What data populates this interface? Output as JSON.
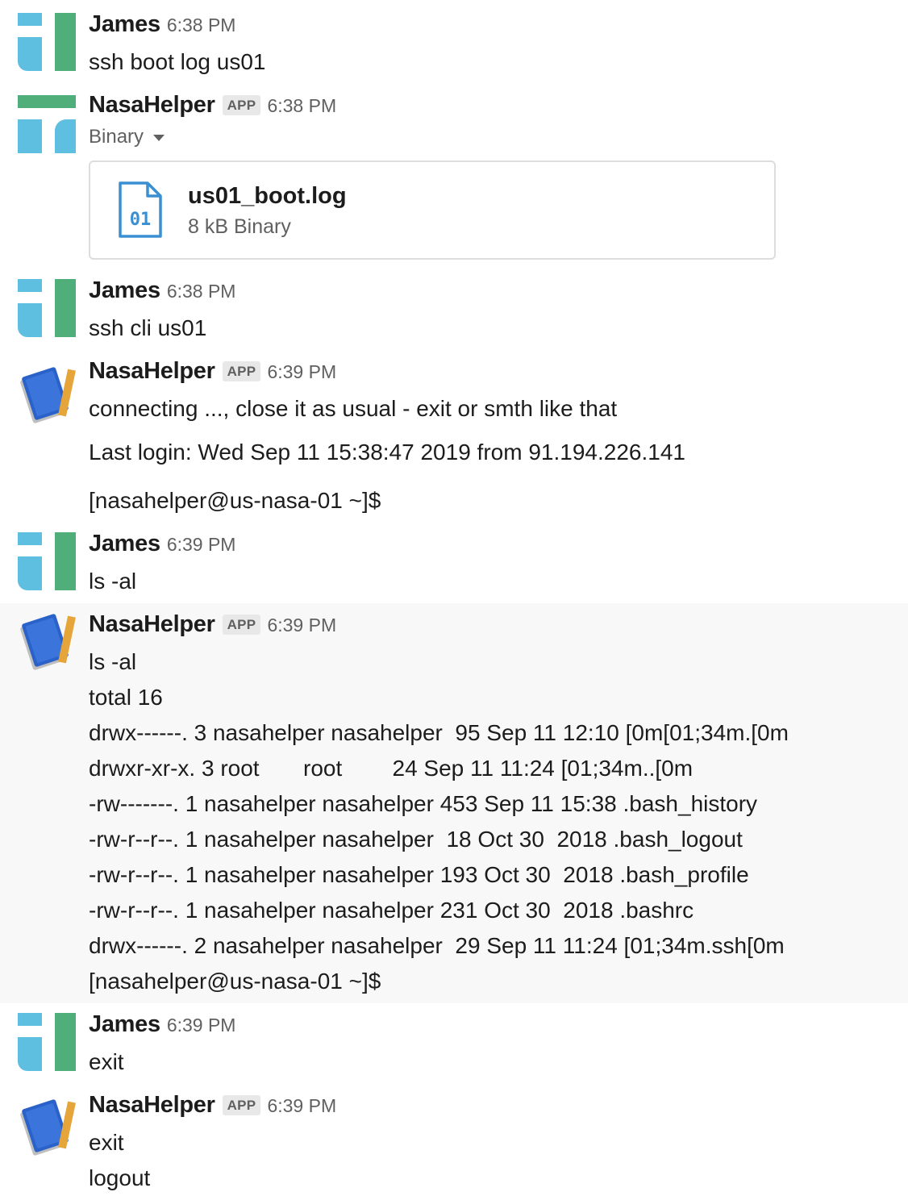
{
  "messages": [
    {
      "author": "James",
      "time": "6:38 PM",
      "avatar_icon": "james-avatar-icon",
      "lines": [
        "ssh boot log us01"
      ]
    },
    {
      "author": "NasaHelper",
      "badge": "APP",
      "time": "6:38 PM",
      "avatar_icon": "nasahelper-avatar-icon",
      "subtitle": "Binary",
      "file": {
        "name": "us01_boot.log",
        "meta": "8 kB Binary",
        "icon_text": "01",
        "icon": "binary-file-icon"
      }
    },
    {
      "author": "James",
      "time": "6:38 PM",
      "avatar_icon": "james-avatar-icon",
      "lines": [
        "ssh cli us01"
      ]
    },
    {
      "author": "NasaHelper",
      "badge": "APP",
      "time": "6:39 PM",
      "avatar_icon": "notebook-avatar-icon",
      "lines": [
        "connecting ..., close it as usual - exit or smth like that",
        "Last login: Wed Sep 11 15:38:47 2019 from 91.194.226.141",
        "[nasahelper@us-nasa-01 ~]$"
      ]
    },
    {
      "author": "James",
      "time": "6:39 PM",
      "avatar_icon": "james-avatar-icon",
      "lines": [
        "ls -al"
      ]
    },
    {
      "author": "NasaHelper",
      "badge": "APP",
      "time": "6:39 PM",
      "avatar_icon": "notebook-avatar-icon",
      "lines": [
        "ls -al",
        "total 16",
        "drwx------. 3 nasahelper nasahelper  95 Sep 11 12:10 [0m[01;34m.[0m",
        "drwxr-xr-x. 3 root       root        24 Sep 11 11:24 [01;34m..[0m",
        "-rw-------. 1 nasahelper nasahelper 453 Sep 11 15:38 .bash_history",
        "-rw-r--r--. 1 nasahelper nasahelper  18 Oct 30  2018 .bash_logout",
        "-rw-r--r--. 1 nasahelper nasahelper 193 Oct 30  2018 .bash_profile",
        "-rw-r--r--. 1 nasahelper nasahelper 231 Oct 30  2018 .bashrc",
        "drwx------. 2 nasahelper nasahelper  29 Sep 11 11:24 [01;34m.ssh[0m",
        "[nasahelper@us-nasa-01 ~]$"
      ]
    },
    {
      "author": "James",
      "time": "6:39 PM",
      "avatar_icon": "james-avatar-icon",
      "lines": [
        "exit"
      ]
    },
    {
      "author": "NasaHelper",
      "badge": "APP",
      "time": "6:39 PM",
      "avatar_icon": "notebook-avatar-icon",
      "lines": [
        "exit",
        "logout"
      ]
    }
  ],
  "colors": {
    "avatar_blue": "#5fbfe0",
    "avatar_green": "#4fae7a",
    "notebook_blue": "#2a62c9",
    "pencil_orange": "#e6a53a",
    "file_icon_blue": "#3a8fd3",
    "highlight_bg": "#f8f8f8"
  }
}
